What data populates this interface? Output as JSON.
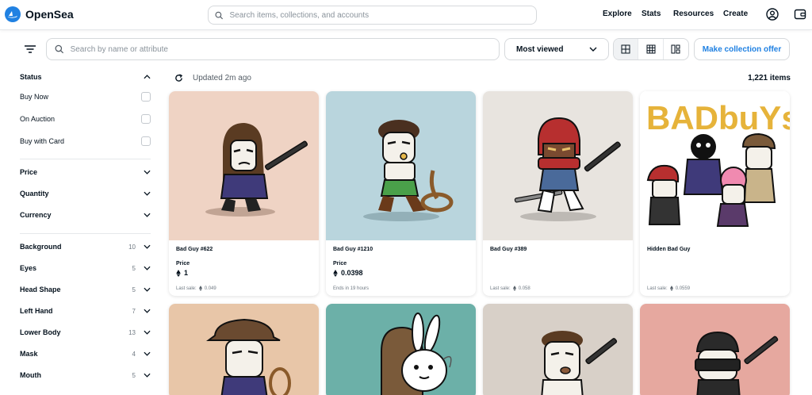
{
  "app": {
    "name": "OpenSea",
    "brand_color": "#2081e2"
  },
  "search": {
    "placeholder": "Search items, collections, and accounts"
  },
  "nav": {
    "explore": "Explore",
    "stats": "Stats",
    "resources": "Resources",
    "create": "Create"
  },
  "toolbar": {
    "attr_placeholder": "Search by name or attribute",
    "sort_selected": "Most viewed",
    "offer_label": "Make collection offer"
  },
  "results": {
    "updated": "Updated 2m ago",
    "count": "1,221 items"
  },
  "sidebar": {
    "status": {
      "label": "Status",
      "options": [
        "Buy Now",
        "On Auction",
        "Buy with Card"
      ]
    },
    "filters": [
      "Price",
      "Quantity",
      "Currency"
    ],
    "traits": [
      {
        "label": "Background",
        "count": "10"
      },
      {
        "label": "Eyes",
        "count": "5"
      },
      {
        "label": "Head Shape",
        "count": "5"
      },
      {
        "label": "Left Hand",
        "count": "7"
      },
      {
        "label": "Lower Body",
        "count": "13"
      },
      {
        "label": "Mask",
        "count": "4"
      },
      {
        "label": "Mouth",
        "count": "5"
      }
    ]
  },
  "cards": [
    {
      "name": "Bad Guy #622",
      "price_label": "Price",
      "price": "1",
      "footer": "Last sale: ",
      "footer_value": "0.049",
      "bg": "#efd3c4"
    },
    {
      "name": "Bad Guy #1210",
      "price_label": "Price",
      "price": "0.0398",
      "footer": "Ends in 19 hours",
      "bg": "#b9d5dd"
    },
    {
      "name": "Bad Guy #389",
      "price_label": "",
      "price": "",
      "footer": "Last sale: ",
      "footer_value": "0.058",
      "bg": "#e8e4df"
    },
    {
      "name": "Hidden Bad Guy",
      "price_label": "",
      "price": "",
      "footer": "Last sale: ",
      "footer_value": "0.0559",
      "bg": "#ffffff",
      "banner": "BADbuYs"
    }
  ],
  "cards_row2": [
    {
      "bg": "#e8c6a8"
    },
    {
      "bg": "#6cb0a8"
    },
    {
      "bg": "#d8d0c8"
    },
    {
      "bg": "#e6a89f"
    }
  ]
}
